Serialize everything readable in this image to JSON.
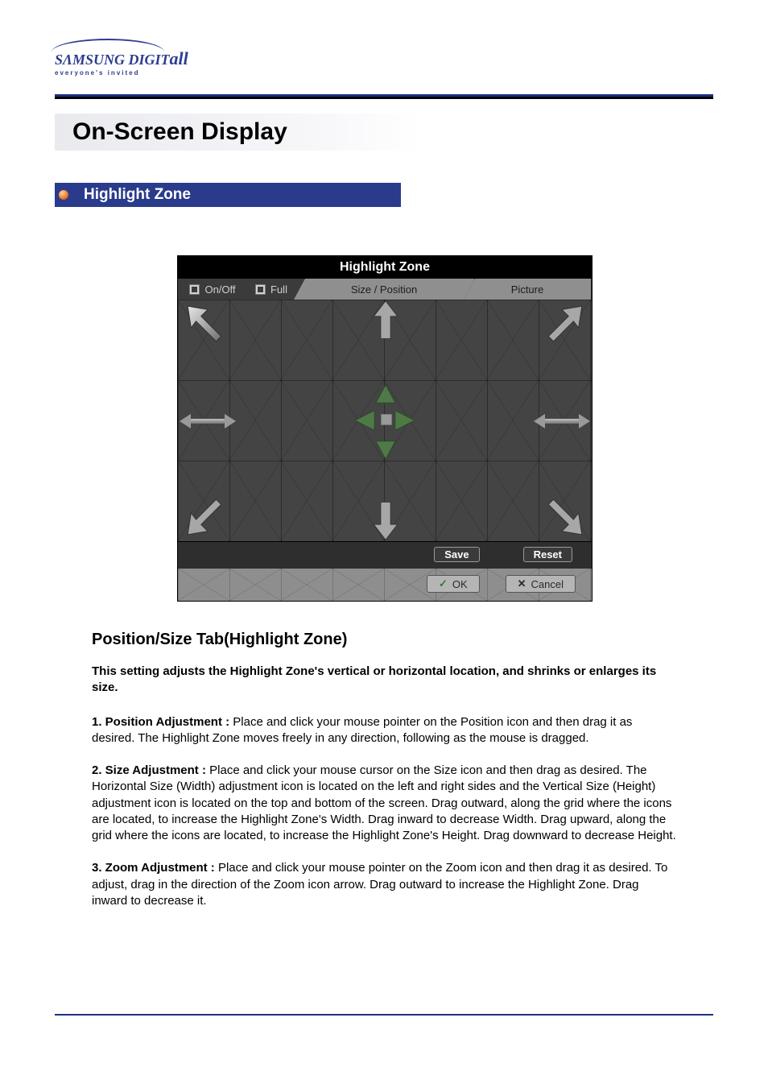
{
  "brand": {
    "name_html_a": "SΛMSUNG ",
    "name_html_b": "DIGIT",
    "name_html_c": "all",
    "tagline": "everyone's invited"
  },
  "doc_title": "On-Screen Display",
  "section": "Highlight Zone",
  "osd": {
    "title": "Highlight Zone",
    "tabs": {
      "onoff": "On/Off",
      "full": "Full",
      "size": "Size / Position",
      "picture": "Picture"
    },
    "buttons": {
      "save": "Save",
      "reset": "Reset",
      "ok": "OK",
      "cancel": "Cancel"
    }
  },
  "content": {
    "heading": "Position/Size Tab(Highlight Zone)",
    "intro": "This setting adjusts the Highlight Zone's vertical or horizontal location, and shrinks or enlarges its size.",
    "p1_lead": "1. Position Adjustment : ",
    "p1_body": "Place and click your mouse pointer on the Position icon and then drag it as desired. The Highlight Zone moves freely in any direction, following as the mouse is dragged.",
    "p2_lead": "2. Size Adjustment : ",
    "p2_body": "Place and click your mouse cursor on the Size icon and then drag as desired. The Horizontal Size (Width) adjustment icon is located on the left and right sides and the Vertical Size (Height) adjustment icon is located on the top and bottom of the screen. Drag outward, along the grid where the icons are located, to increase the Highlight Zone's Width. Drag inward to decrease Width. Drag upward, along the grid where the icons are located, to increase the Highlight Zone's Height. Drag downward to decrease Height.",
    "p3_lead": "3. Zoom Adjustment : ",
    "p3_body": "Place and click your mouse pointer on the Zoom icon and then drag it as desired. To adjust, drag in the direction of the Zoom icon arrow. Drag outward to increase the Highlight Zone. Drag inward to decrease it."
  }
}
